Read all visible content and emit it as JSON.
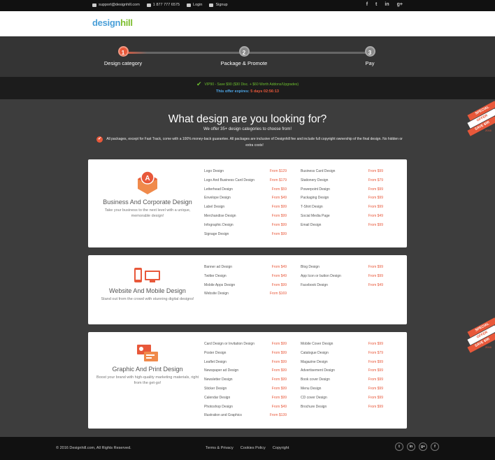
{
  "topbar": {
    "email": "support@designhill.com",
    "phone": "1 877 777 6575",
    "login": "Login",
    "signup": "Signup",
    "social": [
      "f",
      "t",
      "in",
      "g+"
    ]
  },
  "logo": {
    "part1": "design",
    "part2": "hill"
  },
  "steps": [
    {
      "num": "1",
      "label": "Design category"
    },
    {
      "num": "2",
      "label": "Package & Promote"
    },
    {
      "num": "3",
      "label": "Pay"
    }
  ],
  "offer": {
    "line1": "VIP90 - Save $90 ($30 Disc. + $60 Worth Addons/Upgrades)",
    "line2_prefix": "This offer expires:",
    "timer": "5 days 02:56:13"
  },
  "heading": "What design are you looking for?",
  "subheading": "We offer 35+ design categories to choose from!",
  "guarantee": "All packages, except for Fast Track, come with a 100% money-back guarantee. All packages are inclusive of Designhill fee and include full copyright ownership of the final design. No hidden or extra costs!",
  "ribbon": {
    "l1": "SPECIAL",
    "l2": "OFFER",
    "l3": "SAVE $90",
    "year": "2016"
  },
  "cards": [
    {
      "title": "Business And Corporate Design",
      "desc": "Take your business to the next level with a unique, memorable design!",
      "col1": [
        {
          "name": "Logo Design",
          "price": "From $129"
        },
        {
          "name": "Logo And Business Card Design",
          "price": "From $179"
        },
        {
          "name": "Letterhead Design",
          "price": "From $59"
        },
        {
          "name": "Envelope Design",
          "price": "From $49"
        },
        {
          "name": "Label Design",
          "price": "From $99"
        },
        {
          "name": "Merchandise Design",
          "price": "From $99"
        },
        {
          "name": "Infographic Design",
          "price": "From $99"
        },
        {
          "name": "Signage Design",
          "price": "From $99"
        }
      ],
      "col2": [
        {
          "name": "Business Card Design",
          "price": "From $99"
        },
        {
          "name": "Stationery Design",
          "price": "From $79"
        },
        {
          "name": "Powerpoint Design",
          "price": "From $99"
        },
        {
          "name": "Packaging Design",
          "price": "From $99"
        },
        {
          "name": "T-Shirt Design",
          "price": "From $99"
        },
        {
          "name": "Social Media Page",
          "price": "From $49"
        },
        {
          "name": "Email Design",
          "price": "From $99"
        }
      ]
    },
    {
      "title": "Website And Mobile Design",
      "desc": "Stand out from the crowd with stunning digital designs!",
      "col1": [
        {
          "name": "Banner ad Design",
          "price": "From $49"
        },
        {
          "name": "Twitter Design",
          "price": "From $49"
        },
        {
          "name": "Mobile Apps Design",
          "price": "From $99"
        },
        {
          "name": "Website Design",
          "price": "From $169"
        }
      ],
      "col2": [
        {
          "name": "Blog Design",
          "price": "From $99"
        },
        {
          "name": "App Icon or button Design",
          "price": "From $99"
        },
        {
          "name": "Facebook Design",
          "price": "From $49"
        }
      ]
    },
    {
      "title": "Graphic And Print Design",
      "desc": "Boost your brand with high-quality marketing materials, right from the get-go!",
      "col1": [
        {
          "name": "Card Design or Invitation Design",
          "price": "From $99"
        },
        {
          "name": "Poster Design",
          "price": "From $99"
        },
        {
          "name": "Leaflet Design",
          "price": "From $99"
        },
        {
          "name": "Newspaper ad Design",
          "price": "From $99"
        },
        {
          "name": "Newsletter Design",
          "price": "From $99"
        },
        {
          "name": "Sticker Design",
          "price": "From $99"
        },
        {
          "name": "Calendar Design",
          "price": "From $99"
        },
        {
          "name": "Photoshop Design",
          "price": "From $49"
        },
        {
          "name": "Illustration and Graphics",
          "price": "From $139"
        }
      ],
      "col2": [
        {
          "name": "Mobile Cover Design",
          "price": "From $99"
        },
        {
          "name": "Catalogue Design",
          "price": "From $79"
        },
        {
          "name": "Magazine Design",
          "price": "From $99"
        },
        {
          "name": "Advertisement Design",
          "price": "From $99"
        },
        {
          "name": "Book cover Design",
          "price": "From $99"
        },
        {
          "name": "Menu Design",
          "price": "From $99"
        },
        {
          "name": "CD cover Design",
          "price": "From $99"
        },
        {
          "name": "Brochure Design",
          "price": "From $99"
        }
      ]
    }
  ],
  "footer": {
    "copyright": "© 2016 Designhill.com, All Rights Reserved.",
    "links": [
      "Terms & Privacy",
      "Cookies Policy",
      "Copyright"
    ],
    "social": [
      "t",
      "in",
      "g+",
      "f"
    ]
  },
  "colors": {
    "accent": "#e8583a",
    "green": "#6cbf2e",
    "blue": "#4fa9ea"
  }
}
